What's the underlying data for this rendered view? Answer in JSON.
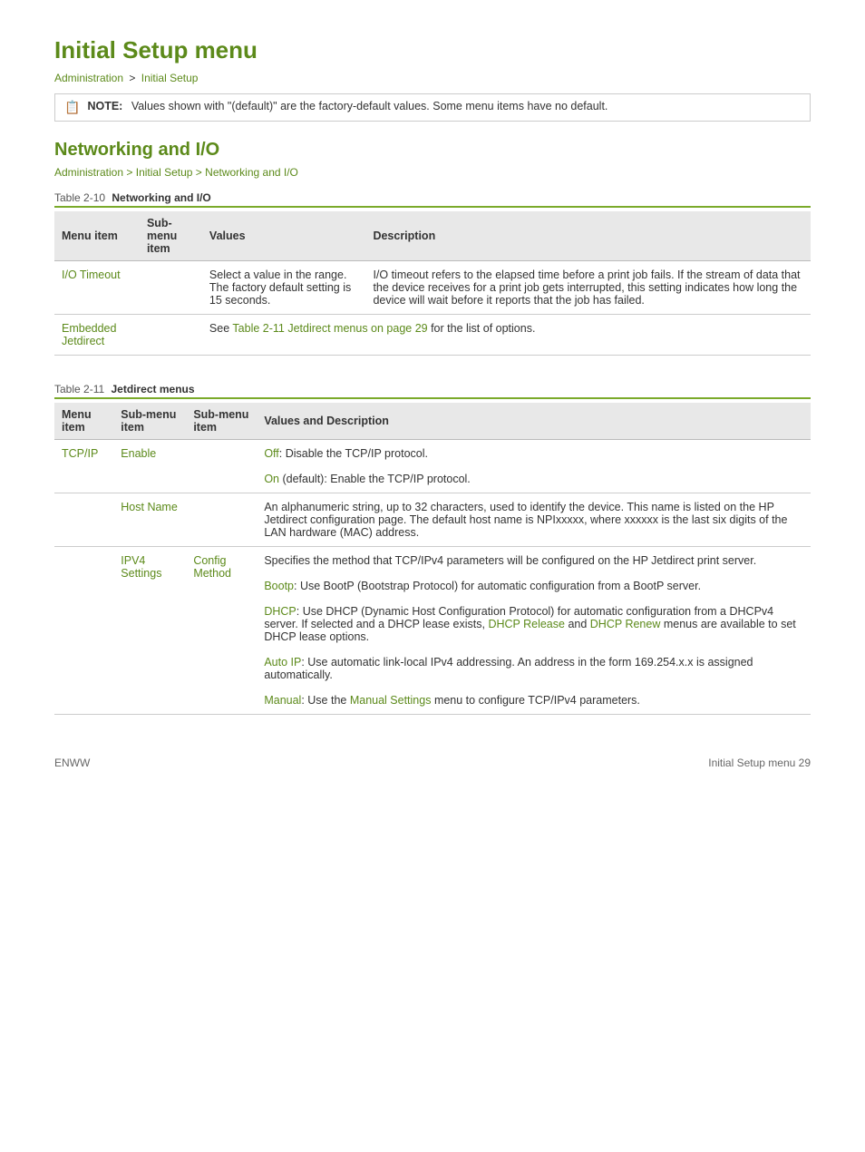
{
  "page": {
    "title": "Initial Setup menu",
    "breadcrumb1": {
      "admin": "Administration",
      "separator": ">",
      "current": "Initial Setup"
    },
    "note_text": "Values shown with \"(default)\" are the factory-default values. Some menu items have no default."
  },
  "section1": {
    "title": "Networking and I/O",
    "breadcrumb": {
      "admin": "Administration",
      "sep1": ">",
      "initial": "Initial Setup",
      "sep2": ">",
      "current": "Networking and I/O"
    },
    "table_caption": "Table 2-10",
    "table_title": "Networking and I/O",
    "headers": [
      "Menu item",
      "Sub-menu item",
      "Values",
      "Description"
    ],
    "rows": [
      {
        "menu_item": "I/O Timeout",
        "sub_menu": "",
        "values": "Select a value in the range. The factory default setting is 15 seconds.",
        "description": "I/O timeout refers to the elapsed time before a print job fails. If the stream of data that the device receives for a print job gets interrupted, this setting indicates how long the device will wait before it reports that the job has failed."
      },
      {
        "menu_item": "Embedded Jetdirect",
        "sub_menu": "",
        "values_link": "See Table 2-11 Jetdirect menus on page 29 for the list of options.",
        "link_text": "Table 2-11 Jetdirect menus on page 29",
        "description": ""
      }
    ]
  },
  "section2": {
    "table_caption": "Table 2-11",
    "table_title": "Jetdirect menus",
    "headers": [
      "Menu item",
      "Sub-menu item",
      "Sub-menu item",
      "Values and Description"
    ],
    "rows": [
      {
        "menu_item": "TCP/IP",
        "sub_menu1": "Enable",
        "sub_menu2": "",
        "values_desc": [
          {
            "text": "Off",
            "link": true,
            "suffix": ": Disable the TCP/IP protocol."
          },
          {
            "text": "On",
            "link": true,
            "suffix": " (default): Enable the TCP/IP protocol."
          }
        ]
      },
      {
        "menu_item": "",
        "sub_menu1": "Host Name",
        "sub_menu2": "",
        "values_desc_plain": "An alphanumeric string, up to 32 characters, used to identify the device. This name is listed on the HP Jetdirect configuration page. The default host name is NPIxxxxx, where xxxxxx is the last six digits of the LAN hardware (MAC) address."
      },
      {
        "menu_item": "",
        "sub_menu1": "IPV4 Settings",
        "sub_menu2": "Config Method",
        "values_desc_complex": [
          {
            "plain": "Specifies the method that TCP/IPv4 parameters will be configured on the HP Jetdirect print server."
          },
          {
            "link": "Bootp",
            "suffix": ": Use BootP (Bootstrap Protocol) for automatic configuration from a BootP server."
          },
          {
            "link": "DHCP",
            "suffix": ": Use DHCP (Dynamic Host Configuration Protocol) for automatic configuration from a DHCPv4 server. If selected and a DHCP lease exists, ",
            "extra_links": [
              {
                "link": "DHCP Release",
                "suffix": " and "
              },
              {
                "link": "DHCP Renew",
                "suffix": " menus are available to set DHCP lease options."
              }
            ]
          },
          {
            "link": "Auto IP",
            "suffix": ": Use automatic link-local IPv4 addressing. An address in the form 169.254.x.x is assigned automatically."
          },
          {
            "link": "Manual",
            "suffix": ": Use the ",
            "extra_links": [
              {
                "link": "Manual Settings",
                "suffix": " menu to configure TCP/IPv4 parameters."
              }
            ]
          }
        ]
      }
    ]
  },
  "footer": {
    "left": "ENWW",
    "right": "Initial Setup menu   29"
  },
  "colors": {
    "green": "#5c8a1a",
    "table_border": "#7aaa2a"
  }
}
